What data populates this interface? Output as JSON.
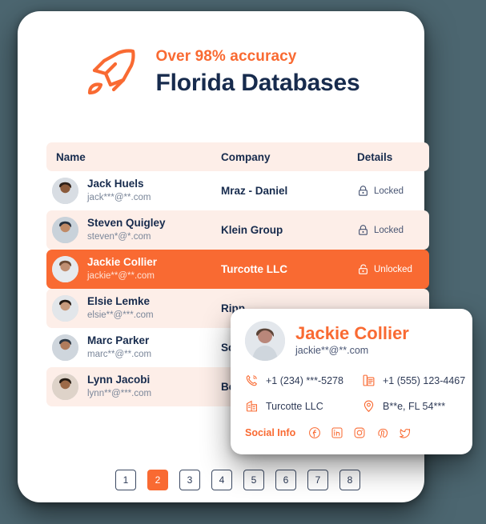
{
  "hero": {
    "subtitle": "Over 98% accuracy",
    "title": "Florida Databases",
    "icon": "rocket-icon"
  },
  "table": {
    "columns": {
      "name": "Name",
      "company": "Company",
      "details": "Details"
    },
    "rows": [
      {
        "name": "Jack Huels",
        "email": "jack***@**.com",
        "company": "Mraz - Daniel",
        "status": "Locked",
        "status_icon": "lock-closed-icon",
        "highlight": false,
        "tint": false
      },
      {
        "name": "Steven Quigley",
        "email": "steven*@*.com",
        "company": "Klein Group",
        "status": "Locked",
        "status_icon": "lock-closed-icon",
        "highlight": false,
        "tint": true
      },
      {
        "name": "Jackie Collier",
        "email": "jackie**@**.com",
        "company": "Turcotte LLC",
        "status": "Unlocked",
        "status_icon": "lock-open-icon",
        "highlight": true,
        "tint": false
      },
      {
        "name": "Elsie Lemke",
        "email": "elsie**@***.com",
        "company": "Ripp",
        "status": "",
        "status_icon": "",
        "highlight": false,
        "tint": true
      },
      {
        "name": "Marc Parker",
        "email": "marc**@**.com",
        "company": "Schu",
        "status": "",
        "status_icon": "",
        "highlight": false,
        "tint": false
      },
      {
        "name": "Lynn Jacobi",
        "email": "lynn**@***.com",
        "company": "Bech",
        "status": "",
        "status_icon": "",
        "highlight": false,
        "tint": true
      }
    ]
  },
  "pagination": {
    "pages": [
      "1",
      "2",
      "3",
      "4",
      "5",
      "6",
      "7",
      "8"
    ],
    "active": "2"
  },
  "detail_card": {
    "name": "Jackie Collier",
    "email": "jackie**@**.com",
    "fields": [
      {
        "icon": "phone-icon",
        "value": "+1 (234) ***-5278"
      },
      {
        "icon": "fax-icon",
        "value": "+1 (555) 123-4467"
      },
      {
        "icon": "building-icon",
        "value": "Turcotte LLC"
      },
      {
        "icon": "pin-icon",
        "value": "B**e, FL 54***"
      }
    ],
    "social_label": "Social Info",
    "social_icons": [
      "facebook-icon",
      "linkedin-icon",
      "instagram-icon",
      "pinterest-icon",
      "twitter-icon"
    ]
  },
  "colors": {
    "accent": "#f96a32",
    "tint": "#fdeee8",
    "dark": "#172b4d",
    "background": "#4c6670"
  }
}
